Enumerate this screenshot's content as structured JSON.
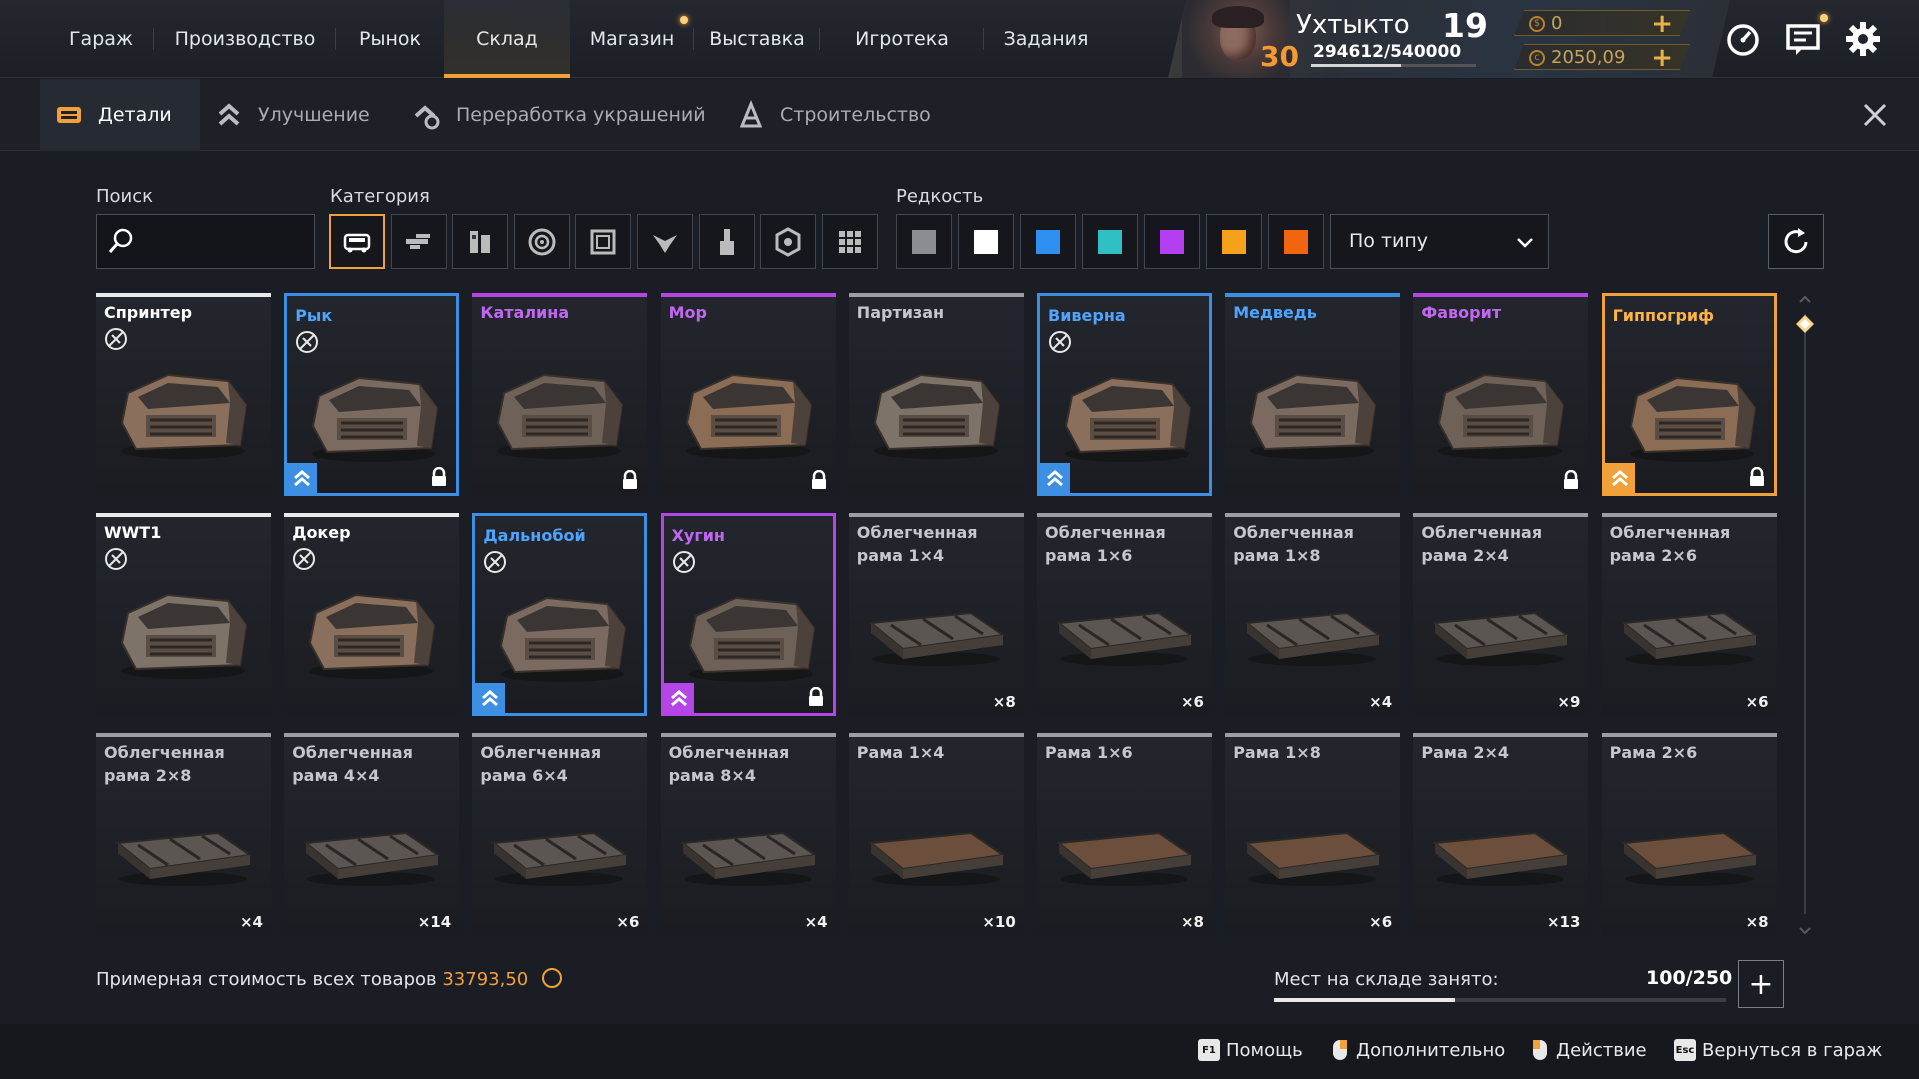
{
  "nav": {
    "items": [
      {
        "label": "Гараж"
      },
      {
        "label": "Производство"
      },
      {
        "label": "Рынок"
      },
      {
        "label": "Склад",
        "active": true
      },
      {
        "label": "Магазин",
        "dot": true
      },
      {
        "label": "Выставка"
      },
      {
        "label": "Игротека"
      },
      {
        "label": "Задания"
      }
    ]
  },
  "player": {
    "name": "Ухтыкто",
    "level": "30",
    "xp": "294612/540000",
    "xp_progress": 0.545,
    "rank": "19",
    "currency1": "0",
    "currency2": "2050,09",
    "add": "+"
  },
  "subtabs": [
    {
      "label": "Детали",
      "active": true,
      "icon": "parts-icon"
    },
    {
      "label": "Улучшение",
      "icon": "upgrade-icon"
    },
    {
      "label": "Переработка украшений",
      "icon": "recycle-decor-icon"
    },
    {
      "label": "Строительство",
      "icon": "construction-icon"
    }
  ],
  "filters": {
    "search_label": "Поиск",
    "search_value": "",
    "category_label": "Категория",
    "rarity_label": "Редкость",
    "sort_value": "По типу",
    "category_icons": [
      "cabin-icon",
      "weapon-icon",
      "module-icon",
      "wheel-icon",
      "frame-icon",
      "decor-icon",
      "paint-icon",
      "hardware-icon",
      "all-icon"
    ],
    "rarity_colors": [
      "#8a8d92",
      "#ffffff",
      "#2d8ff0",
      "#2fbfc4",
      "#b33ff0",
      "#f5a21a",
      "#f2650f"
    ]
  },
  "colors": {
    "common": "#9a9da2",
    "special": "#e9eaec",
    "rare": "#3d8fe3",
    "epic": "#b445e6",
    "legendary": "#f2a03a",
    "accent": "#f2a03a"
  },
  "items": [
    {
      "name": "Спринтер",
      "rarity": "special",
      "noedit": true
    },
    {
      "name": "Рык",
      "rarity": "rare",
      "framed": true,
      "noedit": true,
      "upgrade": true,
      "lock": true
    },
    {
      "name": "Каталина",
      "rarity": "epic",
      "lock": true
    },
    {
      "name": "Мор",
      "rarity": "epic",
      "lock": true
    },
    {
      "name": "Партизан",
      "rarity": "common"
    },
    {
      "name": "Виверна",
      "rarity": "rare",
      "framed": true,
      "noedit": true,
      "upgrade": true
    },
    {
      "name": "Медведь",
      "rarity": "rare"
    },
    {
      "name": "Фаворит",
      "rarity": "epic",
      "lock": true
    },
    {
      "name": "Гиппогриф",
      "rarity": "legendary",
      "framed": true,
      "upgrade": true,
      "lock": true
    },
    {
      "name": "WWT1",
      "rarity": "special",
      "noedit": true
    },
    {
      "name": "Докер",
      "rarity": "special",
      "noedit": true
    },
    {
      "name": "Дальнобой",
      "rarity": "rare",
      "framed": true,
      "noedit": true,
      "upgrade": true
    },
    {
      "name": "Хугин",
      "rarity": "epic",
      "framed": true,
      "noedit": true,
      "upgrade": true,
      "lock": true
    },
    {
      "name": "Облегченная рама 1×4",
      "rarity": "common",
      "count": "×8"
    },
    {
      "name": "Облегченная рама 1×6",
      "rarity": "common",
      "count": "×6"
    },
    {
      "name": "Облегченная рама 1×8",
      "rarity": "common",
      "count": "×4"
    },
    {
      "name": "Облегченная рама 2×4",
      "rarity": "common",
      "count": "×9"
    },
    {
      "name": "Облегченная рама 2×6",
      "rarity": "common",
      "count": "×6"
    },
    {
      "name": "Облегченная рама 2×8",
      "rarity": "common",
      "count": "×4"
    },
    {
      "name": "Облегченная рама 4×4",
      "rarity": "common",
      "count": "×14"
    },
    {
      "name": "Облегченная рама 6×4",
      "rarity": "common",
      "count": "×6"
    },
    {
      "name": "Облегченная рама 8×4",
      "rarity": "common",
      "count": "×4"
    },
    {
      "name": "Рама 1×4",
      "rarity": "common",
      "count": "×10"
    },
    {
      "name": "Рама 1×6",
      "rarity": "common",
      "count": "×8"
    },
    {
      "name": "Рама 1×8",
      "rarity": "common",
      "count": "×6"
    },
    {
      "name": "Рама 2×4",
      "rarity": "common",
      "count": "×13"
    },
    {
      "name": "Рама 2×6",
      "rarity": "common",
      "count": "×8"
    }
  ],
  "footer": {
    "total_label": "Примерная стоимость всех товаров",
    "total_value": "33793,50",
    "storage_label": "Мест на складе занято:",
    "storage_value": "100/250",
    "storage_fill": 0.4,
    "storage_add": "+"
  },
  "hints": [
    {
      "key": "F1",
      "label": "Помощь"
    },
    {
      "key": "mouse",
      "label": "Дополнительно"
    },
    {
      "key": "mouse",
      "label": "Действие"
    },
    {
      "key": "Esc",
      "label": "Вернуться в гараж"
    }
  ]
}
